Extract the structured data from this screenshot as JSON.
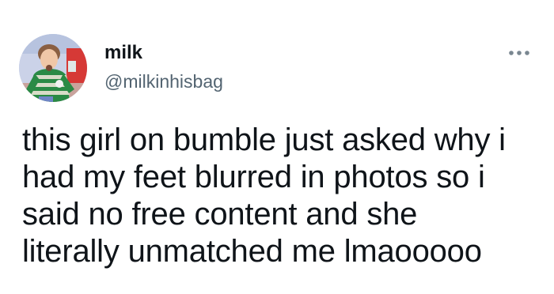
{
  "tweet": {
    "author": {
      "display_name": "milk",
      "handle": "@milkinhisbag",
      "avatar_icon": "profile-photo"
    },
    "more_icon": "more-horizontal-icon",
    "text_lines": [
      "this girl on bumble just asked why i",
      "had my feet blurred in photos so i",
      "said no free content and she",
      "literally unmatched me lmaooooo"
    ]
  }
}
